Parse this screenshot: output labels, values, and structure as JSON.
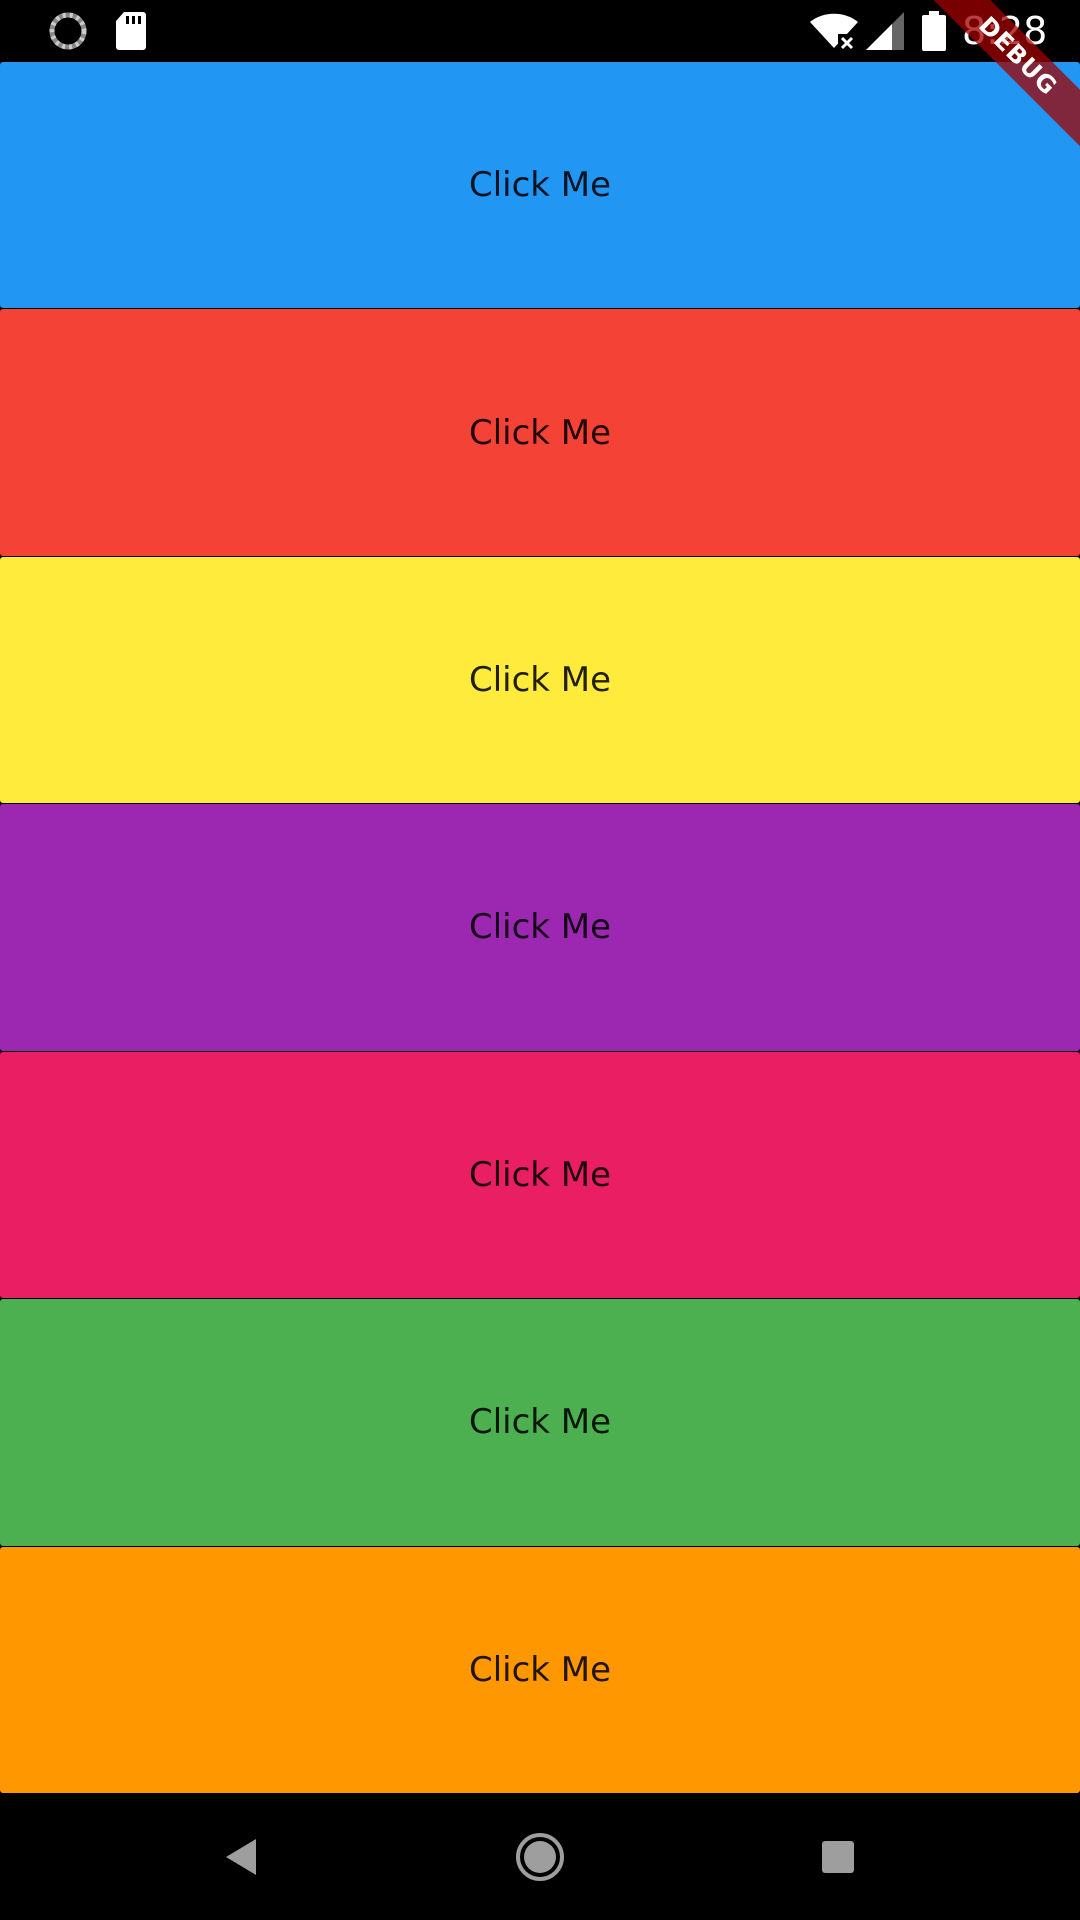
{
  "status_bar": {
    "time": "8:28",
    "icons": [
      "loading-icon",
      "sd-card-icon",
      "wifi-off-icon",
      "cell-signal-icon",
      "battery-icon"
    ]
  },
  "debug_banner": {
    "label": "DEBUG"
  },
  "buttons": [
    {
      "label": "Click Me",
      "color": "#2196F3"
    },
    {
      "label": "Click Me",
      "color": "#F44336"
    },
    {
      "label": "Click Me",
      "color": "#FFEB3B"
    },
    {
      "label": "Click Me",
      "color": "#9C27B0"
    },
    {
      "label": "Click Me",
      "color": "#E91E63"
    },
    {
      "label": "Click Me",
      "color": "#4CAF50"
    },
    {
      "label": "Click Me",
      "color": "#FF9800"
    }
  ],
  "nav_bar": {
    "icons": [
      "back-icon",
      "home-icon",
      "recents-icon"
    ]
  }
}
